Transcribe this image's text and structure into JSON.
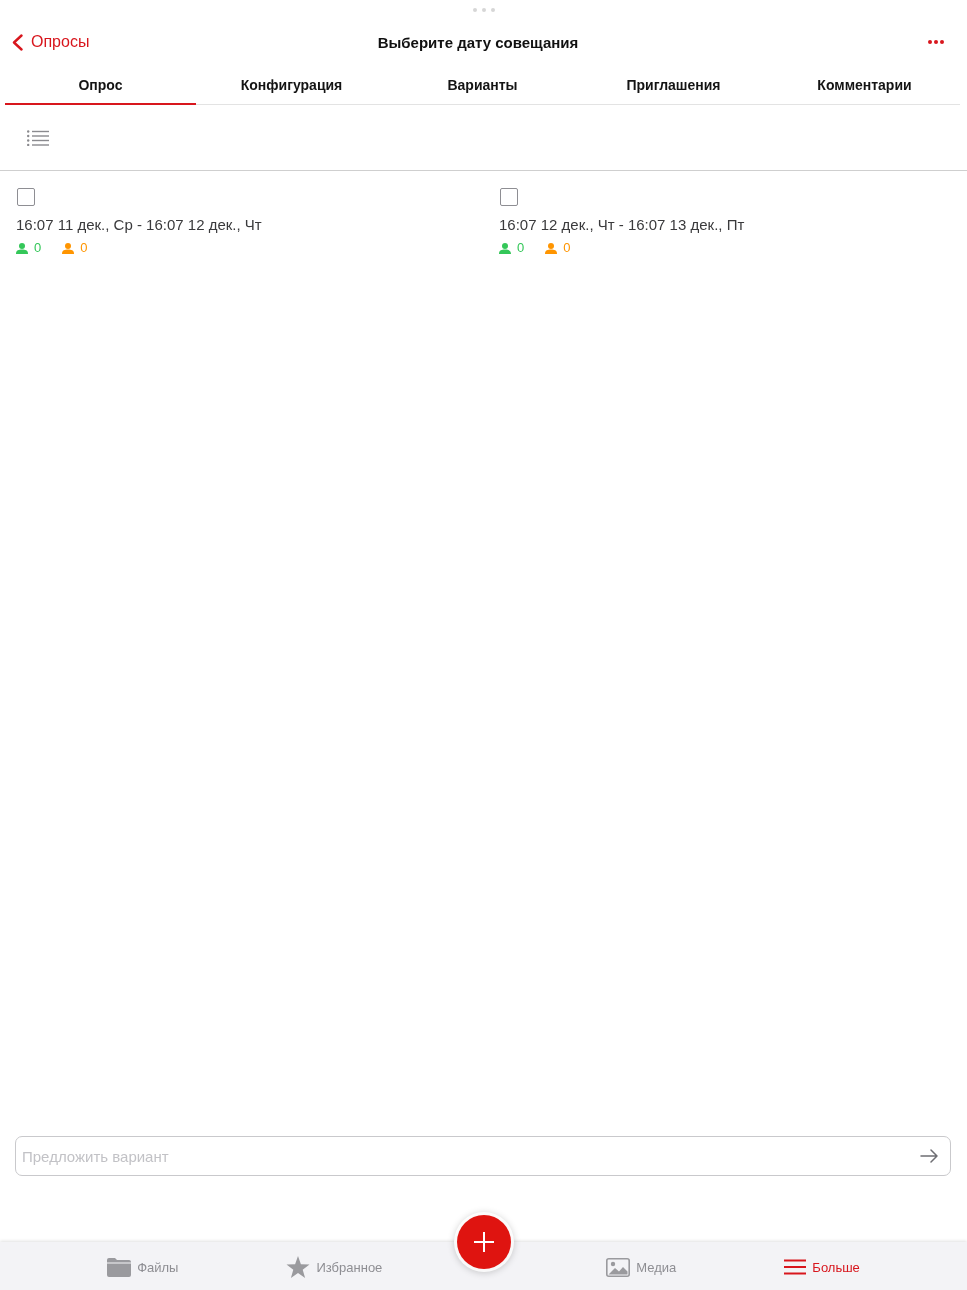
{
  "header": {
    "back_label": "Опросы",
    "title": "Выберите дату совещания"
  },
  "tabs": [
    {
      "label": "Опрос",
      "selected": true
    },
    {
      "label": "Конфигурация",
      "selected": false
    },
    {
      "label": "Варианты",
      "selected": false
    },
    {
      "label": "Приглашения",
      "selected": false
    },
    {
      "label": "Комментарии",
      "selected": false
    }
  ],
  "options": [
    {
      "label": "16:07 11 дек., Ср - 16:07 12 дек., Чт",
      "checked": false,
      "counts": [
        {
          "value": "0",
          "color": "#34c759"
        },
        {
          "value": "0",
          "color": "#ff9500"
        }
      ]
    },
    {
      "label": "16:07 12 дек., Чт - 16:07 13 дек., Пт",
      "checked": false,
      "counts": [
        {
          "value": "0",
          "color": "#34c759"
        },
        {
          "value": "0",
          "color": "#ff9500"
        }
      ]
    }
  ],
  "suggest_field": {
    "placeholder": "Предложить вариант"
  },
  "bottom_bar": {
    "items": [
      {
        "label": "Файлы",
        "kind": "folder",
        "selected": false
      },
      {
        "label": "Избранное",
        "kind": "star",
        "selected": false
      },
      {
        "label": "Медиа",
        "kind": "image",
        "selected": false
      },
      {
        "label": "Больше",
        "kind": "menu",
        "selected": true
      }
    ]
  }
}
